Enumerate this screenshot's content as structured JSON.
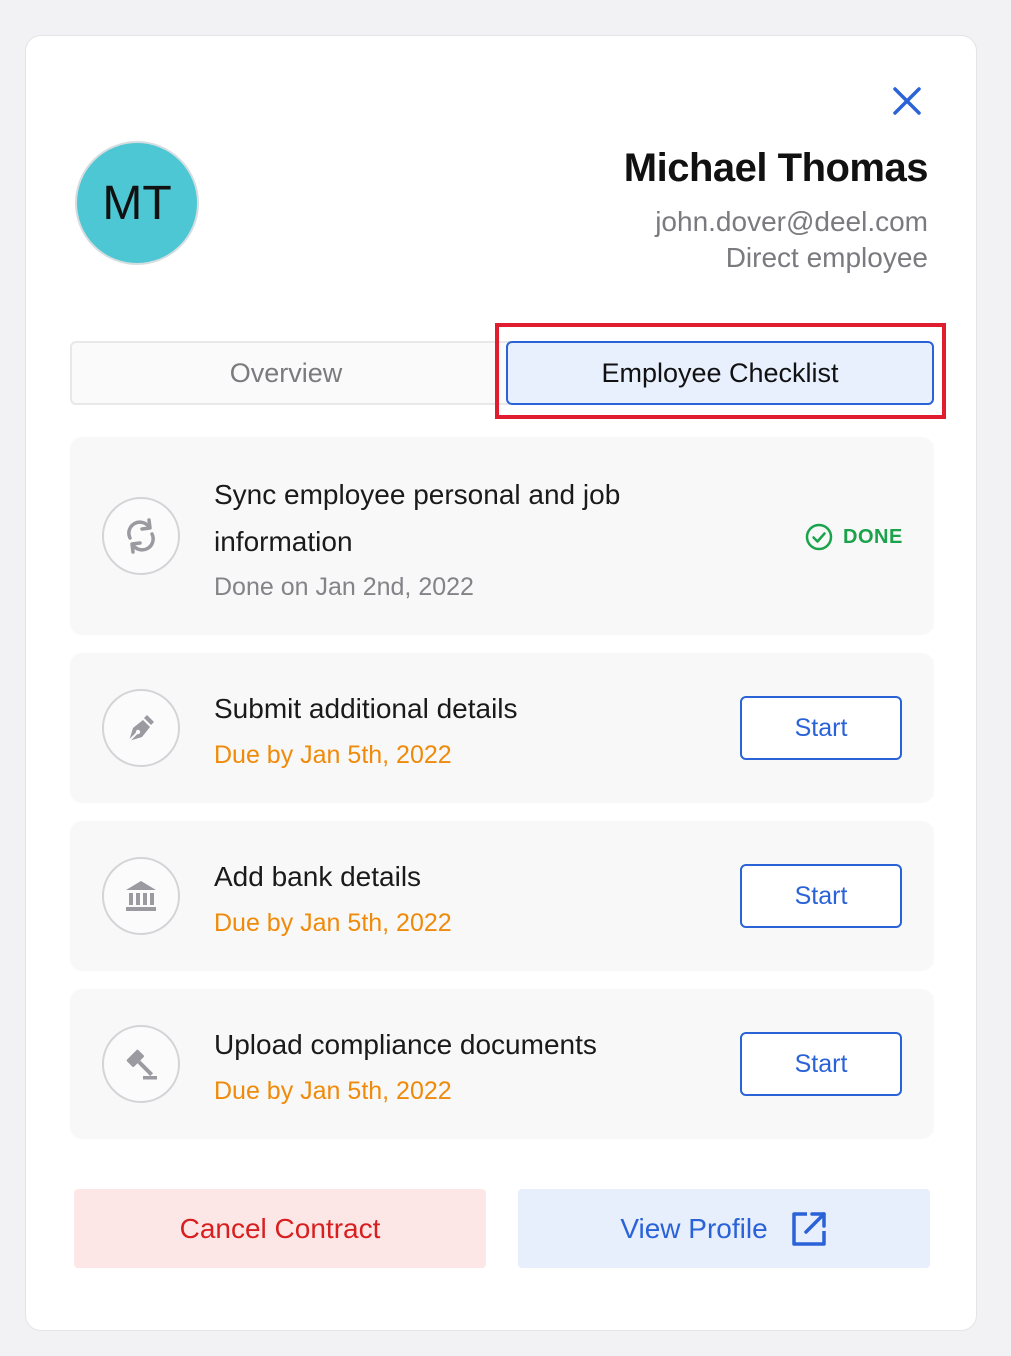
{
  "profile": {
    "initials": "MT",
    "name": "Michael Thomas",
    "email": "john.dover@deel.com",
    "role": "Direct employee",
    "avatar_color": "#4cc7d3"
  },
  "tabs": [
    {
      "label": "Overview",
      "active": false
    },
    {
      "label": "Employee Checklist",
      "active": true
    }
  ],
  "tasks": [
    {
      "title": "Sync employee personal and job information",
      "subtitle": "Done on Jan 2nd, 2022",
      "status": "DONE",
      "icon": "sync-icon"
    },
    {
      "title": "Submit additional details",
      "subtitle": "Due by Jan 5th, 2022",
      "action": "Start",
      "icon": "pen-nib-icon"
    },
    {
      "title": "Add bank details",
      "subtitle": "Due by Jan 5th, 2022",
      "action": "Start",
      "icon": "bank-icon"
    },
    {
      "title": "Upload compliance documents",
      "subtitle": "Due by Jan 5th, 2022",
      "action": "Start",
      "icon": "gavel-icon"
    }
  ],
  "footer": {
    "cancel_label": "Cancel Contract",
    "profile_label": "View Profile"
  },
  "colors": {
    "accent": "#2a62d8",
    "done": "#1aa34a",
    "due": "#ef8a0a",
    "danger": "#d81f1f",
    "highlight": "#e01d2e"
  }
}
